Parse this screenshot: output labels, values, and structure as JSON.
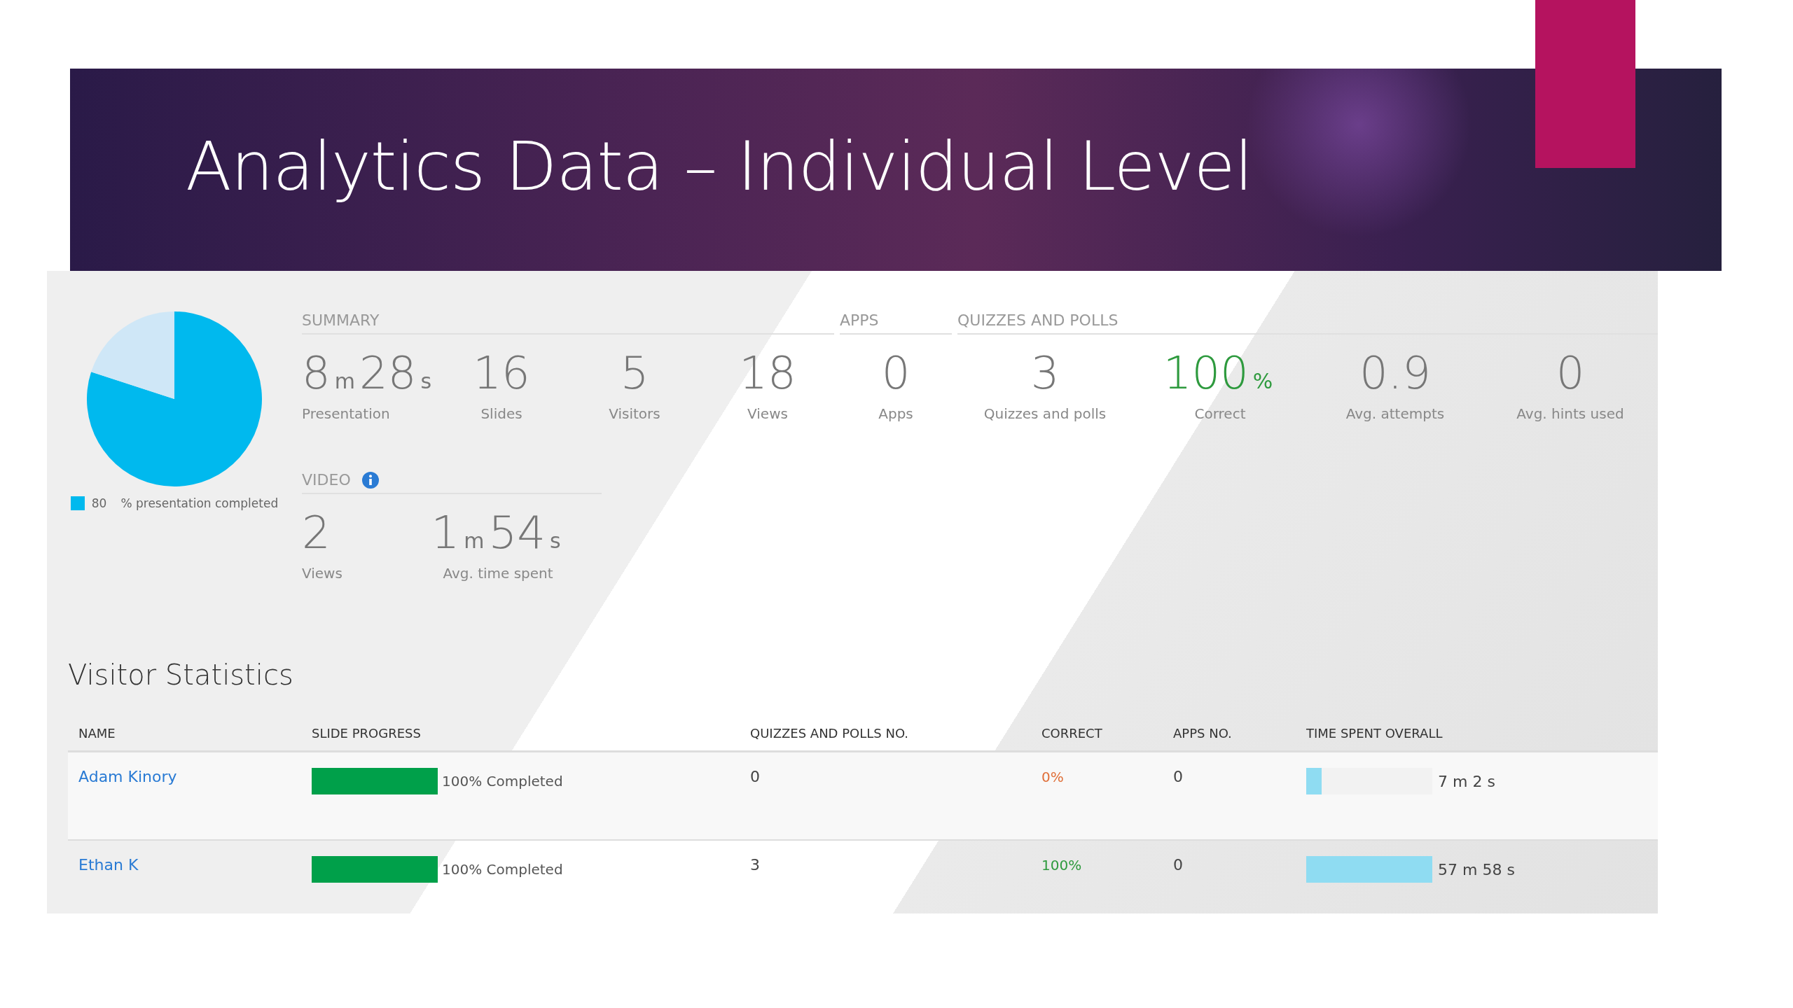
{
  "slide": {
    "title": "Analytics Data – Individual Level"
  },
  "progress": {
    "chart_data": {
      "type": "pie",
      "values": [
        80,
        20
      ]
    },
    "value": "80",
    "label": "% presentation completed"
  },
  "groups": [
    {
      "title": "SUMMARY",
      "stats": [
        {
          "parts": [
            {
              "kind": "number",
              "text": "8"
            },
            {
              "kind": "unit",
              "text": "m"
            },
            {
              "kind": "number",
              "text": "28"
            },
            {
              "kind": "unit",
              "text": "s"
            }
          ],
          "label": "Presentation",
          "color": "#777777"
        },
        {
          "parts": [
            {
              "kind": "number",
              "text": "16"
            }
          ],
          "label": "Slides",
          "color": "#777777"
        },
        {
          "parts": [
            {
              "kind": "number",
              "text": "5"
            }
          ],
          "label": "Visitors",
          "color": "#777777"
        },
        {
          "parts": [
            {
              "kind": "number",
              "text": "18"
            }
          ],
          "label": "Views",
          "color": "#777777"
        }
      ]
    },
    {
      "title": "APPS",
      "stats": [
        {
          "parts": [
            {
              "kind": "number",
              "text": "0"
            }
          ],
          "label": "Apps",
          "color": "#777777"
        }
      ]
    },
    {
      "title": "QUIZZES AND POLLS",
      "stats": [
        {
          "parts": [
            {
              "kind": "number",
              "text": "3"
            }
          ],
          "label": "Quizzes and polls",
          "color": "#777777"
        },
        {
          "parts": [
            {
              "kind": "number",
              "text": "100"
            },
            {
              "kind": "unit",
              "text": "%"
            }
          ],
          "label": "Correct",
          "color": "#2e9a3e"
        },
        {
          "parts": [
            {
              "kind": "number",
              "text": "0.9"
            }
          ],
          "label": "Avg. attempts",
          "color": "#777777"
        },
        {
          "parts": [
            {
              "kind": "number",
              "text": "0"
            }
          ],
          "label": "Avg. hints used",
          "color": "#777777"
        }
      ]
    }
  ],
  "video": {
    "title": "VIDEO",
    "stats": [
      {
        "parts": [
          {
            "kind": "number",
            "text": "2"
          }
        ],
        "label": "Views",
        "color": "#777777"
      },
      {
        "parts": [
          {
            "kind": "number",
            "text": "1"
          },
          {
            "kind": "unit",
            "text": "m"
          },
          {
            "kind": "number",
            "text": "54"
          },
          {
            "kind": "unit",
            "text": "s"
          }
        ],
        "label": "Avg. time spent",
        "color": "#777777"
      }
    ]
  },
  "visitor_statistics": {
    "title": "Visitor Statistics",
    "columns": [
      "NAME",
      "SLIDE PROGRESS",
      "QUIZZES AND POLLS NO.",
      "CORRECT",
      "APPS NO.",
      "TIME SPENT OVERALL"
    ],
    "rows": [
      {
        "name": "Adam Kinory",
        "progress": {
          "level": 1,
          "label": "100% Completed"
        },
        "quizzes": "0",
        "correct": {
          "text": "0%",
          "color": "#e0703a"
        },
        "apps": "0",
        "time": {
          "level": 0.12,
          "text": "7 m 2 s"
        }
      },
      {
        "name": "Ethan K",
        "progress": {
          "level": 1,
          "label": "100% Completed"
        },
        "quizzes": "3",
        "correct": {
          "text": "100%",
          "color": "#2e9a3e"
        },
        "apps": "0",
        "time": {
          "level": 1,
          "text": "57 m 58 s"
        }
      }
    ]
  }
}
